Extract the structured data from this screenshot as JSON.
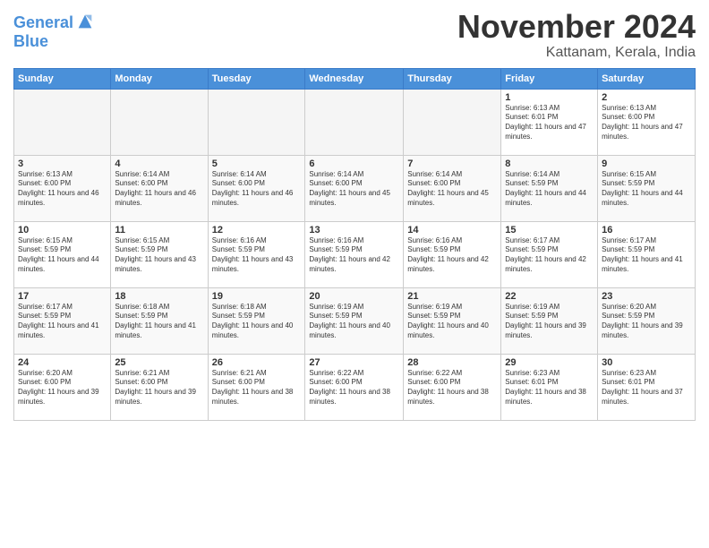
{
  "header": {
    "logo_line1": "General",
    "logo_line2": "Blue",
    "month_title": "November 2024",
    "location": "Kattanam, Kerala, India"
  },
  "days_of_week": [
    "Sunday",
    "Monday",
    "Tuesday",
    "Wednesday",
    "Thursday",
    "Friday",
    "Saturday"
  ],
  "weeks": [
    [
      {
        "day": "",
        "empty": true
      },
      {
        "day": "",
        "empty": true
      },
      {
        "day": "",
        "empty": true
      },
      {
        "day": "",
        "empty": true
      },
      {
        "day": "",
        "empty": true
      },
      {
        "day": "1",
        "sunrise": "6:13 AM",
        "sunset": "6:01 PM",
        "daylight": "11 hours and 47 minutes."
      },
      {
        "day": "2",
        "sunrise": "6:13 AM",
        "sunset": "6:00 PM",
        "daylight": "11 hours and 47 minutes."
      }
    ],
    [
      {
        "day": "3",
        "sunrise": "6:13 AM",
        "sunset": "6:00 PM",
        "daylight": "11 hours and 46 minutes."
      },
      {
        "day": "4",
        "sunrise": "6:14 AM",
        "sunset": "6:00 PM",
        "daylight": "11 hours and 46 minutes."
      },
      {
        "day": "5",
        "sunrise": "6:14 AM",
        "sunset": "6:00 PM",
        "daylight": "11 hours and 46 minutes."
      },
      {
        "day": "6",
        "sunrise": "6:14 AM",
        "sunset": "6:00 PM",
        "daylight": "11 hours and 45 minutes."
      },
      {
        "day": "7",
        "sunrise": "6:14 AM",
        "sunset": "6:00 PM",
        "daylight": "11 hours and 45 minutes."
      },
      {
        "day": "8",
        "sunrise": "6:14 AM",
        "sunset": "5:59 PM",
        "daylight": "11 hours and 44 minutes."
      },
      {
        "day": "9",
        "sunrise": "6:15 AM",
        "sunset": "5:59 PM",
        "daylight": "11 hours and 44 minutes."
      }
    ],
    [
      {
        "day": "10",
        "sunrise": "6:15 AM",
        "sunset": "5:59 PM",
        "daylight": "11 hours and 44 minutes."
      },
      {
        "day": "11",
        "sunrise": "6:15 AM",
        "sunset": "5:59 PM",
        "daylight": "11 hours and 43 minutes."
      },
      {
        "day": "12",
        "sunrise": "6:16 AM",
        "sunset": "5:59 PM",
        "daylight": "11 hours and 43 minutes."
      },
      {
        "day": "13",
        "sunrise": "6:16 AM",
        "sunset": "5:59 PM",
        "daylight": "11 hours and 42 minutes."
      },
      {
        "day": "14",
        "sunrise": "6:16 AM",
        "sunset": "5:59 PM",
        "daylight": "11 hours and 42 minutes."
      },
      {
        "day": "15",
        "sunrise": "6:17 AM",
        "sunset": "5:59 PM",
        "daylight": "11 hours and 42 minutes."
      },
      {
        "day": "16",
        "sunrise": "6:17 AM",
        "sunset": "5:59 PM",
        "daylight": "11 hours and 41 minutes."
      }
    ],
    [
      {
        "day": "17",
        "sunrise": "6:17 AM",
        "sunset": "5:59 PM",
        "daylight": "11 hours and 41 minutes."
      },
      {
        "day": "18",
        "sunrise": "6:18 AM",
        "sunset": "5:59 PM",
        "daylight": "11 hours and 41 minutes."
      },
      {
        "day": "19",
        "sunrise": "6:18 AM",
        "sunset": "5:59 PM",
        "daylight": "11 hours and 40 minutes."
      },
      {
        "day": "20",
        "sunrise": "6:19 AM",
        "sunset": "5:59 PM",
        "daylight": "11 hours and 40 minutes."
      },
      {
        "day": "21",
        "sunrise": "6:19 AM",
        "sunset": "5:59 PM",
        "daylight": "11 hours and 40 minutes."
      },
      {
        "day": "22",
        "sunrise": "6:19 AM",
        "sunset": "5:59 PM",
        "daylight": "11 hours and 39 minutes."
      },
      {
        "day": "23",
        "sunrise": "6:20 AM",
        "sunset": "5:59 PM",
        "daylight": "11 hours and 39 minutes."
      }
    ],
    [
      {
        "day": "24",
        "sunrise": "6:20 AM",
        "sunset": "6:00 PM",
        "daylight": "11 hours and 39 minutes."
      },
      {
        "day": "25",
        "sunrise": "6:21 AM",
        "sunset": "6:00 PM",
        "daylight": "11 hours and 39 minutes."
      },
      {
        "day": "26",
        "sunrise": "6:21 AM",
        "sunset": "6:00 PM",
        "daylight": "11 hours and 38 minutes."
      },
      {
        "day": "27",
        "sunrise": "6:22 AM",
        "sunset": "6:00 PM",
        "daylight": "11 hours and 38 minutes."
      },
      {
        "day": "28",
        "sunrise": "6:22 AM",
        "sunset": "6:00 PM",
        "daylight": "11 hours and 38 minutes."
      },
      {
        "day": "29",
        "sunrise": "6:23 AM",
        "sunset": "6:01 PM",
        "daylight": "11 hours and 38 minutes."
      },
      {
        "day": "30",
        "sunrise": "6:23 AM",
        "sunset": "6:01 PM",
        "daylight": "11 hours and 37 minutes."
      }
    ]
  ]
}
